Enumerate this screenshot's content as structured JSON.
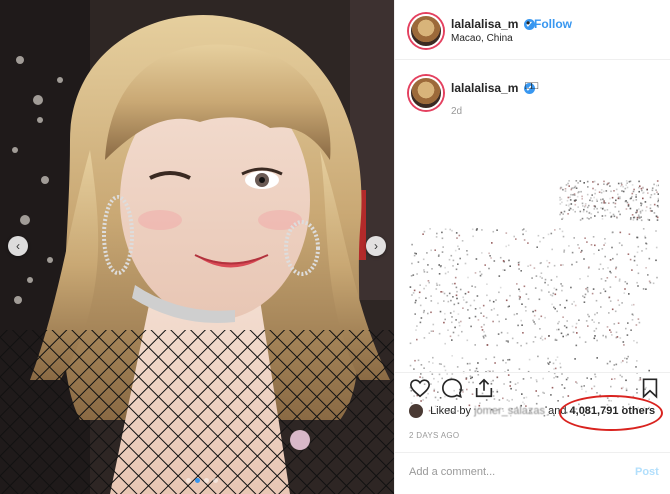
{
  "header": {
    "username": "lalalalisa_m",
    "separator": "•",
    "follow_label": "Follow",
    "location": "Macao, China"
  },
  "caption": {
    "username": "lalalalisa_m",
    "text": "□□",
    "time_ago": "2d"
  },
  "likes": {
    "prefix": "Liked by",
    "liker": "jomer_salazas",
    "conjunction": "and",
    "others": "4,081,791 others"
  },
  "posted_at": "2 DAYS AGO",
  "add_comment": {
    "placeholder": "Add a comment...",
    "post_label": "Post"
  },
  "photo": {
    "carousel_pages": 4,
    "carousel_active": 2
  },
  "icons": {
    "verified": "✔",
    "prev": "‹",
    "next": "›"
  },
  "colors": {
    "link_blue": "#3897f0",
    "highlight_red": "#d9231f",
    "post_disabled": "#b2dffc"
  }
}
